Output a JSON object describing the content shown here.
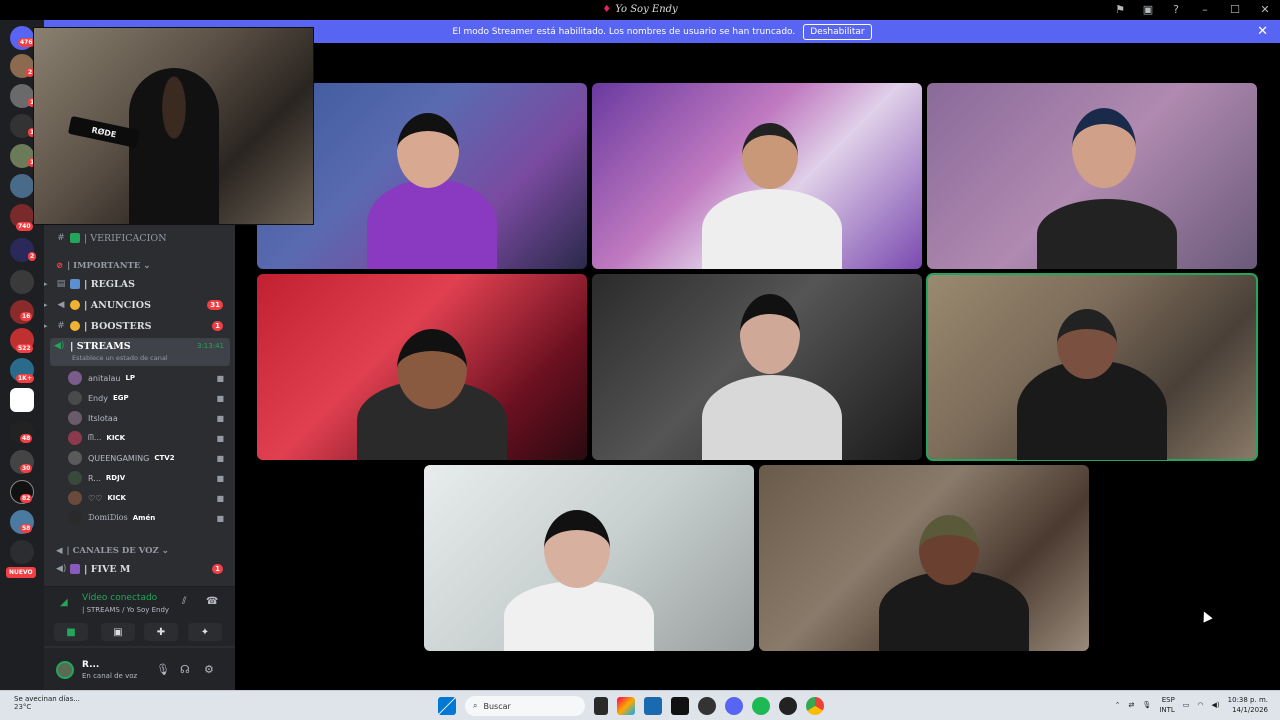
{
  "window": {
    "title": "Yo Soy Endy"
  },
  "banner": {
    "message": "El modo Streamer está habilitado. Los nombres de usuario se han truncado.",
    "button_label": "Deshabilitar"
  },
  "rail": {
    "home_badge": "476",
    "badges": [
      "2",
      "1",
      "1",
      "1",
      "740",
      "2",
      "16",
      "522",
      "1K+",
      "48",
      "30",
      "82",
      "58"
    ],
    "nuevo_label": "NUEVO"
  },
  "webcam": {
    "mic_brand": "RØDE"
  },
  "sidebar": {
    "verificacion": "| VERIFICACION",
    "category_importante": "| IMPORTANTE",
    "channels": [
      {
        "name": "| REGLAS",
        "badge": ""
      },
      {
        "name": "| ANUNCIOS",
        "badge": "31"
      },
      {
        "name": "| BOOSTERS",
        "badge": "1"
      }
    ],
    "streams": {
      "name": "| STREAMS",
      "status": "Establece un estado de canal",
      "time": "3:13:41"
    },
    "voice_users": [
      {
        "name": "anitalau",
        "tag": "LP",
        "tag_icon": "pencil-icon",
        "color": "#7a5c8a"
      },
      {
        "name": "Endy",
        "tag": "EGP",
        "tag_icon": "tag-icon",
        "color": "#4a4a4a"
      },
      {
        "name": "Itslotaa",
        "tag": "",
        "tag_icon": "",
        "color": "#6a5a6a"
      },
      {
        "name": "ᗰ...",
        "tag": "KICK",
        "tag_icon": "heart-icon",
        "color": "#8a3a4a"
      },
      {
        "name": "QUEENGAMING",
        "tag": "CTV2",
        "tag_icon": "hand-icon",
        "color": "#5a5a5a"
      },
      {
        "name": "R...",
        "tag": "RDJV",
        "tag_icon": "pencil-icon",
        "color": "#3a4a3a"
      },
      {
        "name": "♡♡",
        "tag": "KICK",
        "tag_icon": "heart-icon",
        "color": "#6a4a3a"
      },
      {
        "name": "ᗪomiᗪios",
        "tag": "Amén",
        "tag_icon": "tag-icon",
        "color": "#2a2a2a"
      }
    ],
    "category_voz": "| CANALES DE VOZ",
    "fivem": {
      "name": "| FIVE M",
      "badge": "1"
    }
  },
  "voice_panel": {
    "state": "Vídeo conectado",
    "channel": "| STREAMS / Yo Soy Endy"
  },
  "user_panel": {
    "name": "R...",
    "status": "En canal de voz"
  },
  "taskbar": {
    "weather_title": "Se avecinan días...",
    "weather_temp": "23°C",
    "search_placeholder": "Buscar",
    "lang_top": "ESP",
    "lang_bottom": "INTL",
    "time": "10:38 p. m.",
    "date": "14/1/2026"
  }
}
